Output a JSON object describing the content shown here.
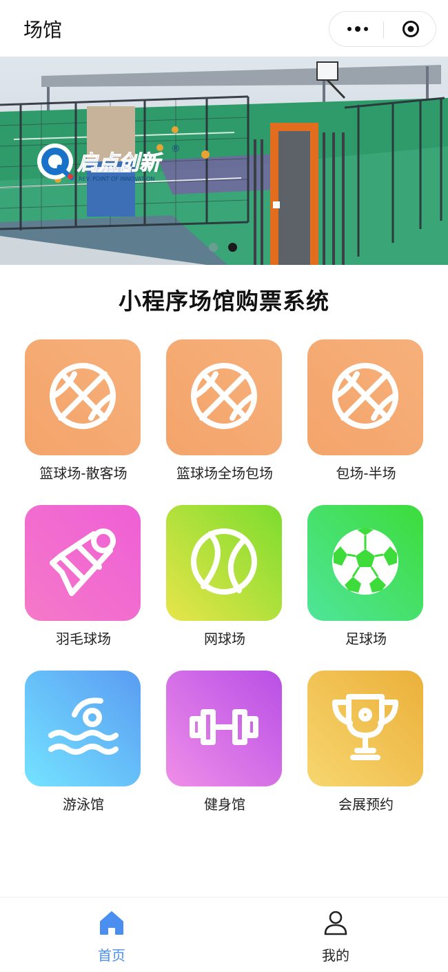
{
  "navbar": {
    "title": "场馆"
  },
  "banner": {
    "logo_text": "启点创新",
    "logo_subtext": "REV. POINT OF INNOVATION",
    "logo_mark": "®",
    "page_count": 2,
    "active_page": 2
  },
  "section": {
    "title": "小程序场馆购票系统"
  },
  "venues": [
    {
      "label": "篮球场-散客场",
      "icon": "basketball-icon",
      "gradient": [
        "#f3a46a",
        "#f7b07b"
      ]
    },
    {
      "label": "篮球场全场包场",
      "icon": "basketball-icon",
      "gradient": [
        "#f3a46a",
        "#f7b07b"
      ]
    },
    {
      "label": "包场-半场",
      "icon": "basketball-icon",
      "gradient": [
        "#f3a46a",
        "#f7b07b"
      ]
    },
    {
      "label": "羽毛球场",
      "icon": "shuttlecock-icon",
      "gradient": [
        "#f579c8",
        "#ee5fd6"
      ]
    },
    {
      "label": "网球场",
      "icon": "tennis-ball-icon",
      "gradient": [
        "#e8e54a",
        "#7bdc2e"
      ]
    },
    {
      "label": "足球场",
      "icon": "soccer-ball-icon",
      "gradient": [
        "#4fe59a",
        "#3ddc3a"
      ]
    },
    {
      "label": "游泳馆",
      "icon": "swimming-icon",
      "gradient": [
        "#74e3ff",
        "#5a9cf2"
      ]
    },
    {
      "label": "健身馆",
      "icon": "dumbbell-icon",
      "gradient": [
        "#f08ee8",
        "#b84fe6"
      ]
    },
    {
      "label": "会展预约",
      "icon": "trophy-icon",
      "gradient": [
        "#f7d66f",
        "#ebb03a"
      ]
    }
  ],
  "tabbar": {
    "items": [
      {
        "label": "首页",
        "icon": "home-icon",
        "active": true
      },
      {
        "label": "我的",
        "icon": "user-icon",
        "active": false
      }
    ]
  },
  "colors": {
    "tab_active": "#4a8ff0",
    "tab_inactive": "#222222"
  }
}
